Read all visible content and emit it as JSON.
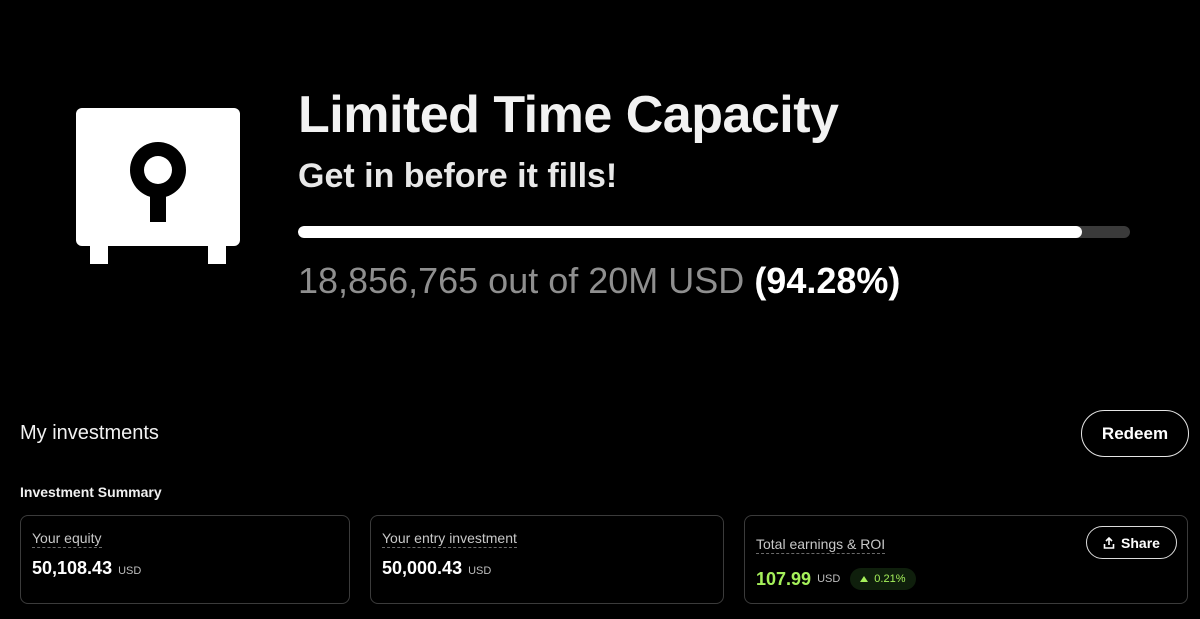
{
  "hero": {
    "title": "Limited Time Capacity",
    "subtitle": "Get in before it fills!",
    "progress_fraction": 0.9428,
    "progress_amount": "18,856,765 out of 20M USD",
    "progress_percent": "(94.28%)",
    "icon": "safe-icon"
  },
  "investments": {
    "title": "My investments",
    "redeem_label": "Redeem",
    "summary_label": "Investment Summary",
    "cards": [
      {
        "label": "Your equity",
        "value": "50,108.43",
        "unit": "USD"
      },
      {
        "label": "Your entry investment",
        "value": "50,000.43",
        "unit": "USD"
      },
      {
        "label": "Total earnings & ROI",
        "value": "107.99",
        "unit": "USD",
        "roi": "0.21%",
        "share_label": "Share"
      }
    ]
  },
  "colors": {
    "background": "#000000",
    "accent_green": "#a5f05a",
    "progress_track": "#3a3a3a"
  }
}
